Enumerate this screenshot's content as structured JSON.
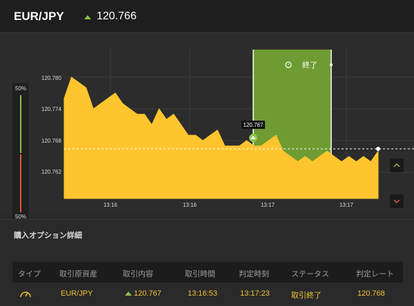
{
  "header": {
    "pair": "EUR/JPY",
    "direction_icon": "up-arrow-icon",
    "current_rate": "120.766"
  },
  "side_meter": {
    "top_label": "50%",
    "bottom_label": "50%",
    "close_label": "×",
    "high_share": 0.5,
    "low_share": 0.5
  },
  "chart": {
    "y_ticks": [
      "120.780",
      "120.774",
      "120.768",
      "120.762"
    ],
    "x_ticks": [
      "13:16",
      "13:16",
      "13:17",
      "13:17"
    ],
    "entry_tooltip": "120.767",
    "expiry_label": "終了",
    "clock_icon": "clock-icon",
    "colors": {
      "area": "#ffc52e",
      "window": "#6f9c32",
      "grid": "#3b3b3b"
    },
    "high_button_icon": "high-arrow-icon",
    "low_button_icon": "low-arrow-icon"
  },
  "chart_data": {
    "type": "area",
    "x": [
      "13:16",
      "13:16",
      "13:17",
      "13:17"
    ],
    "y_ticks": [
      120.78,
      120.774,
      120.768,
      120.762
    ],
    "entry_rate": 120.767,
    "current_rate": 120.766,
    "series": [
      {
        "values": [
          120.776,
          120.78,
          120.779,
          120.778,
          120.774,
          120.775,
          120.776,
          120.777,
          120.775,
          120.774,
          120.773,
          120.773,
          120.771,
          120.774,
          120.772,
          120.773,
          120.771,
          120.769,
          120.769,
          120.768,
          120.769,
          120.77,
          120.767,
          120.767,
          120.767,
          120.768,
          120.767,
          120.767,
          120.768,
          120.769,
          120.766,
          120.765,
          120.764,
          120.765,
          120.764,
          120.765,
          120.766,
          120.765,
          120.764,
          120.765,
          120.764,
          120.765,
          120.764,
          120.766
        ]
      }
    ]
  },
  "details": {
    "title": "購入オプション詳細",
    "columns": [
      "タイプ",
      "取引原資産",
      "取引内容",
      "取引時間",
      "判定時刻",
      "ステータス",
      "判定レート"
    ],
    "row": {
      "type_icon": "gauge-icon",
      "asset": "EUR/JPY",
      "direction_icon": "up-arrow-icon",
      "trade": "120.767",
      "trade_time": "13:16:53",
      "judge_time": "13:17:23",
      "status": "取引終了",
      "judge_rate": "120.768"
    }
  }
}
